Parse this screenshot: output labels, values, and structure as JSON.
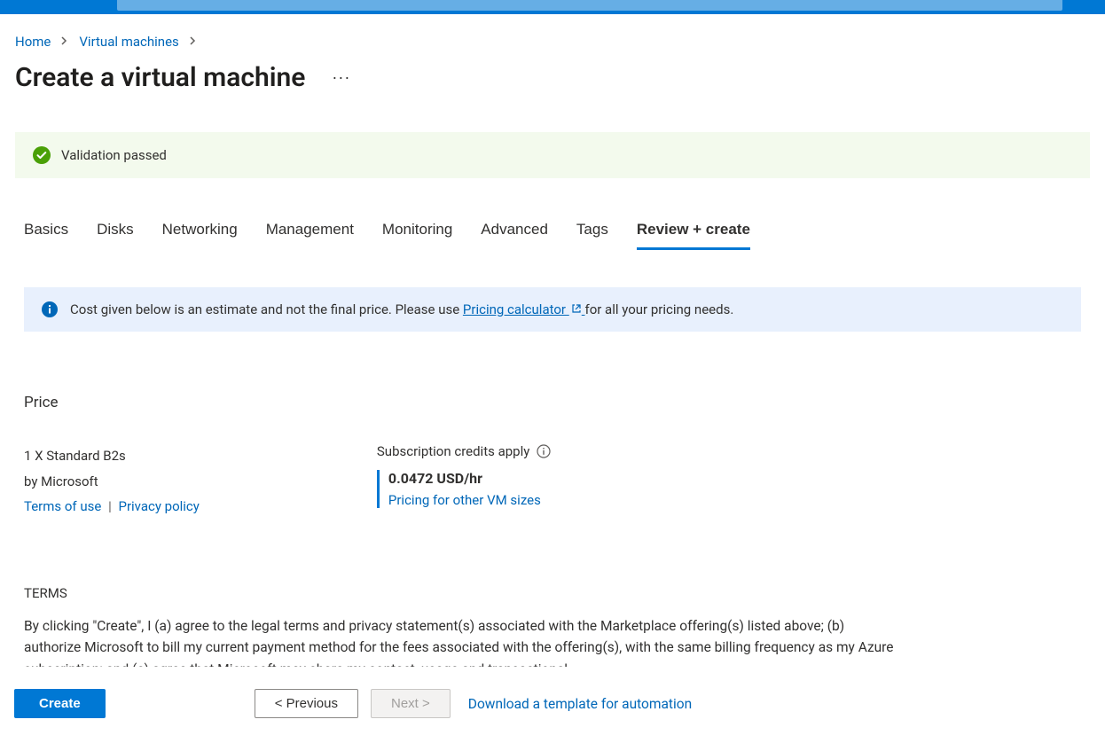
{
  "breadcrumb": {
    "home": "Home",
    "vms": "Virtual machines"
  },
  "page_title": "Create a virtual machine",
  "validation": {
    "text": "Validation passed"
  },
  "tabs": {
    "basics": "Basics",
    "disks": "Disks",
    "networking": "Networking",
    "management": "Management",
    "monitoring": "Monitoring",
    "advanced": "Advanced",
    "tags": "Tags",
    "review": "Review + create"
  },
  "info_banner": {
    "prefix": "Cost given below is an estimate and not the final price. Please use ",
    "link": "Pricing calculator",
    "suffix": " for all your pricing needs."
  },
  "price": {
    "heading": "Price",
    "sku": "1 X Standard B2s",
    "vendor": "by Microsoft",
    "terms_link": "Terms of use",
    "privacy_link": "Privacy policy",
    "credits_label": "Subscription credits apply",
    "amount": "0.0472 USD/hr",
    "other_sizes_link": "Pricing for other VM sizes"
  },
  "terms": {
    "heading": "TERMS",
    "body": "By clicking \"Create\", I (a) agree to the legal terms and privacy statement(s) associated with the Marketplace offering(s) listed above; (b) authorize Microsoft to bill my current payment method for the fees associated with the offering(s), with the same billing frequency as my Azure subscription; and (c) agree that Microsoft may share my contact, usage and transactional"
  },
  "footer": {
    "create": "Create",
    "previous": "< Previous",
    "next": "Next >",
    "download_template": "Download a template for automation"
  }
}
